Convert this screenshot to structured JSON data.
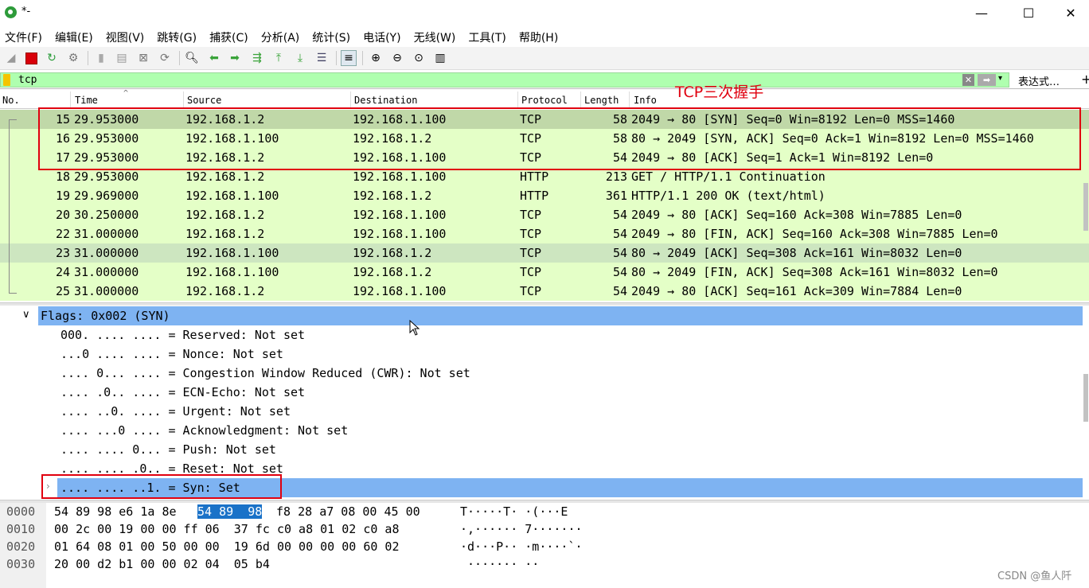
{
  "window": {
    "title": "*-",
    "minimize": "—",
    "maximize": "☐",
    "close": "✕"
  },
  "menu": [
    "文件(F)",
    "编辑(E)",
    "视图(V)",
    "跳转(G)",
    "捕获(C)",
    "分析(A)",
    "统计(S)",
    "电话(Y)",
    "无线(W)",
    "工具(T)",
    "帮助(H)"
  ],
  "toolbar_icons": [
    "shark-fin-icon",
    "stop-icon",
    "restart-icon",
    "options-gear-icon",
    "open-file-icon",
    "save-file-icon",
    "close-file-icon",
    "reload-icon",
    "find-icon",
    "back-arrow-icon",
    "forward-arrow-icon",
    "goto-packet-icon",
    "first-packet-icon",
    "last-packet-icon",
    "autoscroll-icon",
    "colorize-icon",
    "zoom-in-icon",
    "zoom-out-icon",
    "zoom-normal-icon",
    "resize-columns-icon"
  ],
  "filter": {
    "value": "tcp",
    "expression_label": "表达式…",
    "add": "+"
  },
  "packet_list": {
    "columns": {
      "no": "No.",
      "time": "Time",
      "source": "Source",
      "destination": "Destination",
      "protocol": "Protocol",
      "length": "Length",
      "info": "Info"
    },
    "annotation_label": "TCP三次握手",
    "rows": [
      {
        "no": "15",
        "time": "29.953000",
        "src": "192.168.1.2",
        "dst": "192.168.1.100",
        "proto": "TCP",
        "len": "58",
        "info": "2049 → 80 [SYN] Seq=0 Win=8192 Len=0 MSS=1460"
      },
      {
        "no": "16",
        "time": "29.953000",
        "src": "192.168.1.100",
        "dst": "192.168.1.2",
        "proto": "TCP",
        "len": "58",
        "info": "80 → 2049 [SYN, ACK] Seq=0 Ack=1 Win=8192 Len=0 MSS=1460"
      },
      {
        "no": "17",
        "time": "29.953000",
        "src": "192.168.1.2",
        "dst": "192.168.1.100",
        "proto": "TCP",
        "len": "54",
        "info": "2049 → 80 [ACK] Seq=1 Ack=1 Win=8192 Len=0"
      },
      {
        "no": "18",
        "time": "29.953000",
        "src": "192.168.1.2",
        "dst": "192.168.1.100",
        "proto": "HTTP",
        "len": "213",
        "info": "GET / HTTP/1.1 Continuation"
      },
      {
        "no": "19",
        "time": "29.969000",
        "src": "192.168.1.100",
        "dst": "192.168.1.2",
        "proto": "HTTP",
        "len": "361",
        "info": "HTTP/1.1 200 OK  (text/html)"
      },
      {
        "no": "20",
        "time": "30.250000",
        "src": "192.168.1.2",
        "dst": "192.168.1.100",
        "proto": "TCP",
        "len": "54",
        "info": "2049 → 80 [ACK] Seq=160 Ack=308 Win=7885 Len=0"
      },
      {
        "no": "22",
        "time": "31.000000",
        "src": "192.168.1.2",
        "dst": "192.168.1.100",
        "proto": "TCP",
        "len": "54",
        "info": "2049 → 80 [FIN, ACK] Seq=160 Ack=308 Win=7885 Len=0"
      },
      {
        "no": "23",
        "time": "31.000000",
        "src": "192.168.1.100",
        "dst": "192.168.1.2",
        "proto": "TCP",
        "len": "54",
        "info": "80 → 2049 [ACK] Seq=308 Ack=161 Win=8032 Len=0"
      },
      {
        "no": "24",
        "time": "31.000000",
        "src": "192.168.1.100",
        "dst": "192.168.1.2",
        "proto": "TCP",
        "len": "54",
        "info": "80 → 2049 [FIN, ACK] Seq=308 Ack=161 Win=8032 Len=0"
      },
      {
        "no": "25",
        "time": "31.000000",
        "src": "192.168.1.2",
        "dst": "192.168.1.100",
        "proto": "TCP",
        "len": "54",
        "info": "2049 → 80 [ACK] Seq=161 Ack=309 Win=7884 Len=0"
      }
    ]
  },
  "details": {
    "flags_header": "Flags: 0x002 (SYN)",
    "lines": [
      "000. .... .... = Reserved: Not set",
      "...0 .... .... = Nonce: Not set",
      ".... 0... .... = Congestion Window Reduced (CWR): Not set",
      ".... .0.. .... = ECN-Echo: Not set",
      ".... ..0. .... = Urgent: Not set",
      ".... ...0 .... = Acknowledgment: Not set",
      ".... .... 0... = Push: Not set",
      ".... .... .0.. = Reset: Not set"
    ],
    "syn_line": ".... .... ..1. = Syn: Set"
  },
  "hex": {
    "rows": [
      {
        "offset": "0000",
        "a": "54 89 98 e6 1a 8e",
        "sel": "54 89  98",
        "b": " f8 28 a7 08 00 45 00",
        "ascii": "T·····T· ·(···E"
      },
      {
        "offset": "0010",
        "a": "00 2c 00 19 00 00 ff 06  37 fc c0 a8 01 02 c0 a8",
        "sel": "",
        "b": "",
        "ascii": "·,······ 7·······"
      },
      {
        "offset": "0020",
        "a": "01 64 08 01 00 50 00 00  19 6d 00 00 00 00 60 02",
        "sel": "",
        "b": "",
        "ascii": "·d···P·· ·m····`·"
      },
      {
        "offset": "0030",
        "a": "20 00 d2 b1 00 00 02 04  05 b4",
        "sel": "",
        "b": "",
        "ascii": " ······· ··"
      }
    ]
  },
  "watermark": "CSDN @鱼人阡",
  "colors": {
    "tcp_row": "#e4ffc7",
    "selected_row": "#c0d8a8",
    "filter_valid": "#afffaf",
    "highlight": "#7eb3f2",
    "annotation": "#e0000f"
  }
}
